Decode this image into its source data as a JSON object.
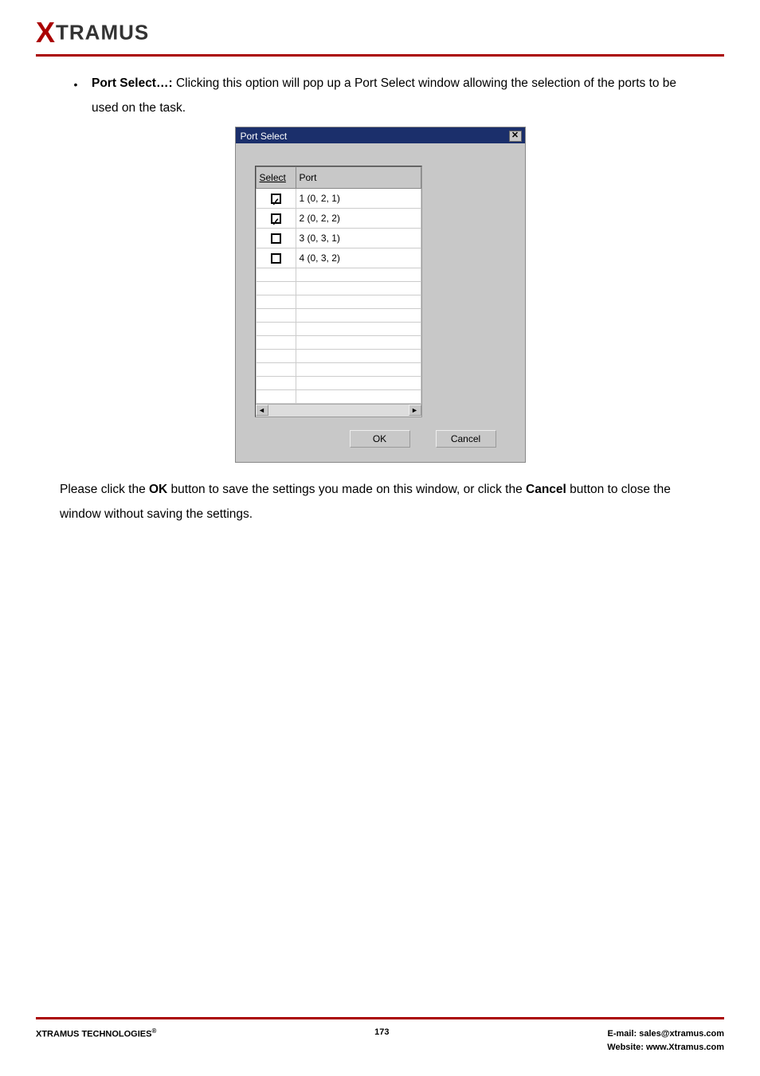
{
  "header": {
    "logo_x": "X",
    "logo_rest": "TRAMUS"
  },
  "content": {
    "bullet_label": "Port Select…:",
    "bullet_text_after": " Clicking this option will pop up a Port Select window allowing the selection of the ports to be used on the task.",
    "closing_1a": "Please click the ",
    "closing_1_ok": "OK",
    "closing_1b": " button to save the settings you made on this window, or click the ",
    "closing_1_cancel": "Cancel",
    "closing_1c": " button to close the window without saving the settings."
  },
  "dialog": {
    "title": "Port Select",
    "close_glyph": "✕",
    "col_select": "Select",
    "col_port": "Port",
    "rows": [
      {
        "checked": true,
        "port": "1 (0, 2, 1)"
      },
      {
        "checked": true,
        "port": "2 (0, 2, 2)"
      },
      {
        "checked": false,
        "port": "3 (0, 3, 1)"
      },
      {
        "checked": false,
        "port": "4 (0, 3, 2)"
      }
    ],
    "scroll_left": "◄",
    "scroll_right": "►",
    "ok_label": "OK",
    "cancel_label": "Cancel"
  },
  "footer": {
    "left_a": "XTRAMUS TECHNOLOGIES",
    "left_sup": "®",
    "page": "173",
    "right_email_label": "E-mail: ",
    "right_email": "sales@xtramus.com",
    "right_site_label": "Website:  ",
    "right_site": "www.Xtramus.com"
  }
}
